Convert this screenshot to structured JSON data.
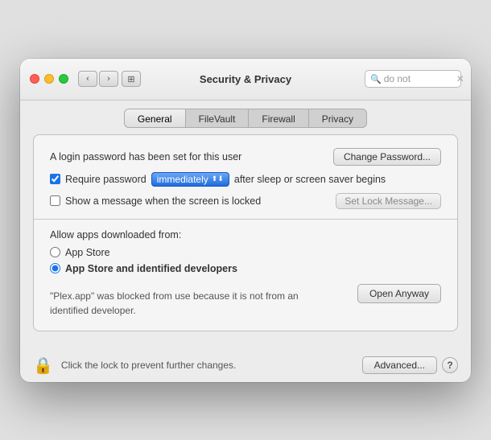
{
  "window": {
    "title": "Security & Privacy",
    "search": {
      "placeholder": "do not",
      "value": "do not"
    }
  },
  "tabs": [
    {
      "id": "general",
      "label": "General",
      "active": true
    },
    {
      "id": "filevault",
      "label": "FileVault",
      "active": false
    },
    {
      "id": "firewall",
      "label": "Firewall",
      "active": false
    },
    {
      "id": "privacy",
      "label": "Privacy",
      "active": false
    }
  ],
  "general": {
    "login_password_label": "A login password has been set for this user",
    "change_password_btn": "Change Password...",
    "require_password_label": "Require password",
    "require_password_checked": true,
    "password_timing": "immediately",
    "after_sleep_label": "after sleep or screen saver begins",
    "show_message_label": "Show a message when the screen is locked",
    "show_message_checked": false,
    "set_lock_message_btn": "Set Lock Message...",
    "allow_apps_label": "Allow apps downloaded from:",
    "app_store_label": "App Store",
    "app_store_identified_label": "App Store and identified developers",
    "app_store_selected": false,
    "app_store_identified_selected": true,
    "blocked_msg": "\"Plex.app\" was blocked from use because it is not from an identified developer.",
    "open_anyway_btn": "Open Anyway"
  },
  "bottom": {
    "lock_label": "Click the lock to prevent further changes.",
    "advanced_btn": "Advanced...",
    "help_btn": "?"
  }
}
